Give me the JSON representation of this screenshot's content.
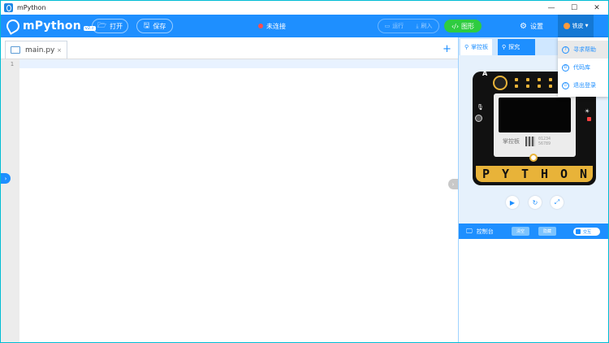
{
  "window": {
    "title": "mPython",
    "controls": [
      "minimize",
      "maximize",
      "close"
    ]
  },
  "toolbar": {
    "logo_text": "mPython",
    "logo_version": "v2.x",
    "open_label": "打开",
    "save_label": "保存",
    "connection_status": "未连接",
    "run_label": "运行",
    "flash_label": "刷入",
    "graphic_label": "图形",
    "settings_label": "设置",
    "user_name": "铁皮",
    "colors": {
      "toolbar": "#1e8fff",
      "graphic_button": "#2ecc40",
      "status_dot": "#ff4d4f"
    }
  },
  "user_menu": {
    "items": [
      {
        "label": "寻求帮助",
        "icon": "help-icon"
      },
      {
        "label": "代码库",
        "icon": "code-library-icon"
      },
      {
        "label": "退出登录",
        "icon": "logout-icon"
      }
    ]
  },
  "editor": {
    "tabs": [
      {
        "label": "main.py",
        "close": "×"
      }
    ],
    "add_tab": "+",
    "line_numbers": [
      "1"
    ]
  },
  "right_panel": {
    "tabs": [
      {
        "label": "掌控板",
        "icon": "board-icon"
      },
      {
        "label": "探究",
        "icon": "explore-icon"
      }
    ],
    "board": {
      "button_a": "A",
      "logo_text": "掌控板",
      "code_text": [
        "01234",
        "56789"
      ],
      "bottom_letters": [
        "P",
        "Y",
        "T",
        "H",
        "O",
        "N"
      ]
    },
    "controls": [
      "play-icon",
      "reset-icon",
      "fullscreen-icon"
    ],
    "console": {
      "title": "控制台",
      "btn1": "清空",
      "btn2": "隐藏",
      "toggle": "交互"
    }
  }
}
